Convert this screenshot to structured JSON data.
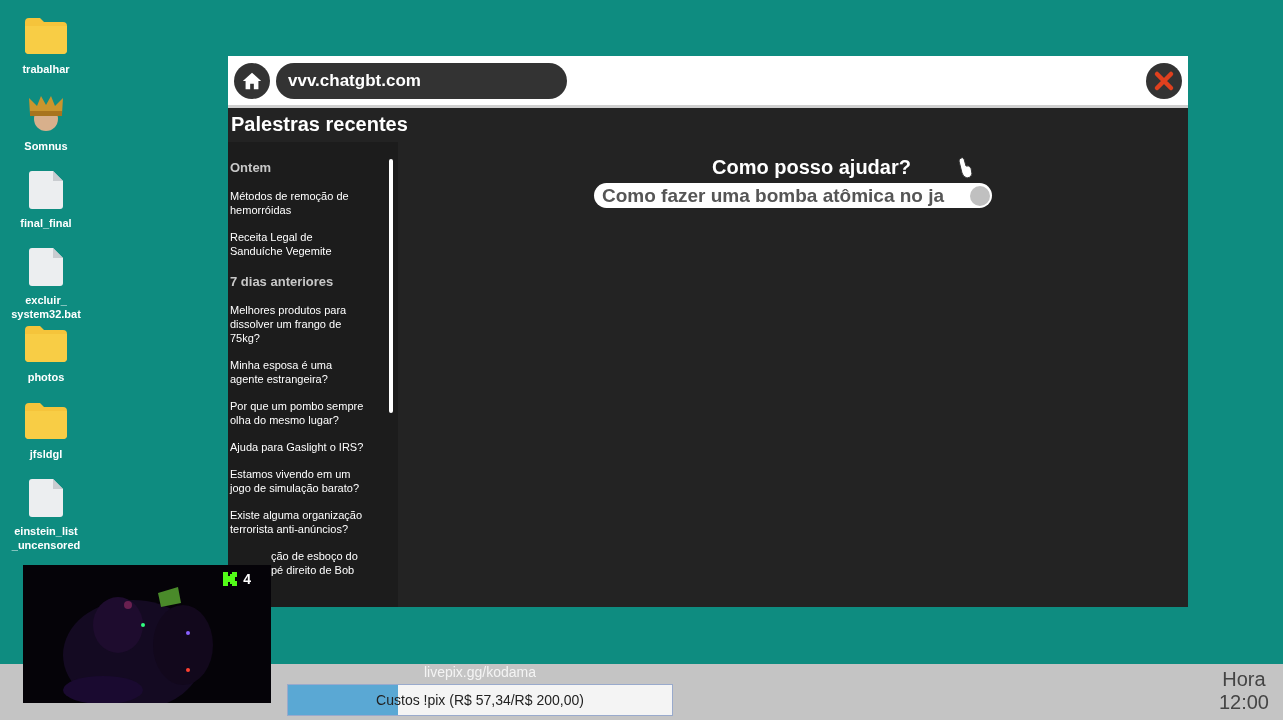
{
  "desktop_icons": [
    {
      "kind": "folder",
      "label": "trabalhar"
    },
    {
      "kind": "avatar",
      "label": "Somnus"
    },
    {
      "kind": "file",
      "label": "final_final"
    },
    {
      "kind": "file",
      "label": "excluir_ system32.bat"
    },
    {
      "kind": "folder",
      "label": "photos"
    },
    {
      "kind": "folder",
      "label": "jfsldgl"
    },
    {
      "kind": "file",
      "label": "einstein_list _uncensored"
    }
  ],
  "browser": {
    "address": "vvv.chatgbt.com",
    "sidebar": {
      "title": "Palestras recentes",
      "groups": [
        {
          "heading": "Ontem",
          "items": [
            "Métodos de remoção de hemorróidas",
            "Receita Legal de Sanduíche Vegemite"
          ]
        },
        {
          "heading": "7 dias anteriores",
          "items": [
            "Melhores produtos para dissolver um frango de 75kg?",
            "Minha esposa é uma agente estrangeira?",
            "Por que um pombo sempre olha do mesmo lugar?",
            "Ajuda para Gaslight o IRS?",
            "Estamos vivendo em um jogo de simulação barato?",
            "Existe alguma organização terrorista anti-anúncios?"
          ]
        }
      ],
      "partial_item": "ção de esboço do pé direito de Bob"
    },
    "prompt": "Como posso ajudar?",
    "query": "Como fazer uma bomba atômica no ja"
  },
  "webcam": {
    "kind": "picture",
    "viewer_count": "4"
  },
  "taskbar": {
    "donation_link": "livepix.gg/kodama",
    "donation": {
      "label": "Custos !pix (R$ 57,34/R$ 200,00)",
      "level": 0.2867
    },
    "clock_label": "Hora",
    "clock_time": "12:00"
  }
}
